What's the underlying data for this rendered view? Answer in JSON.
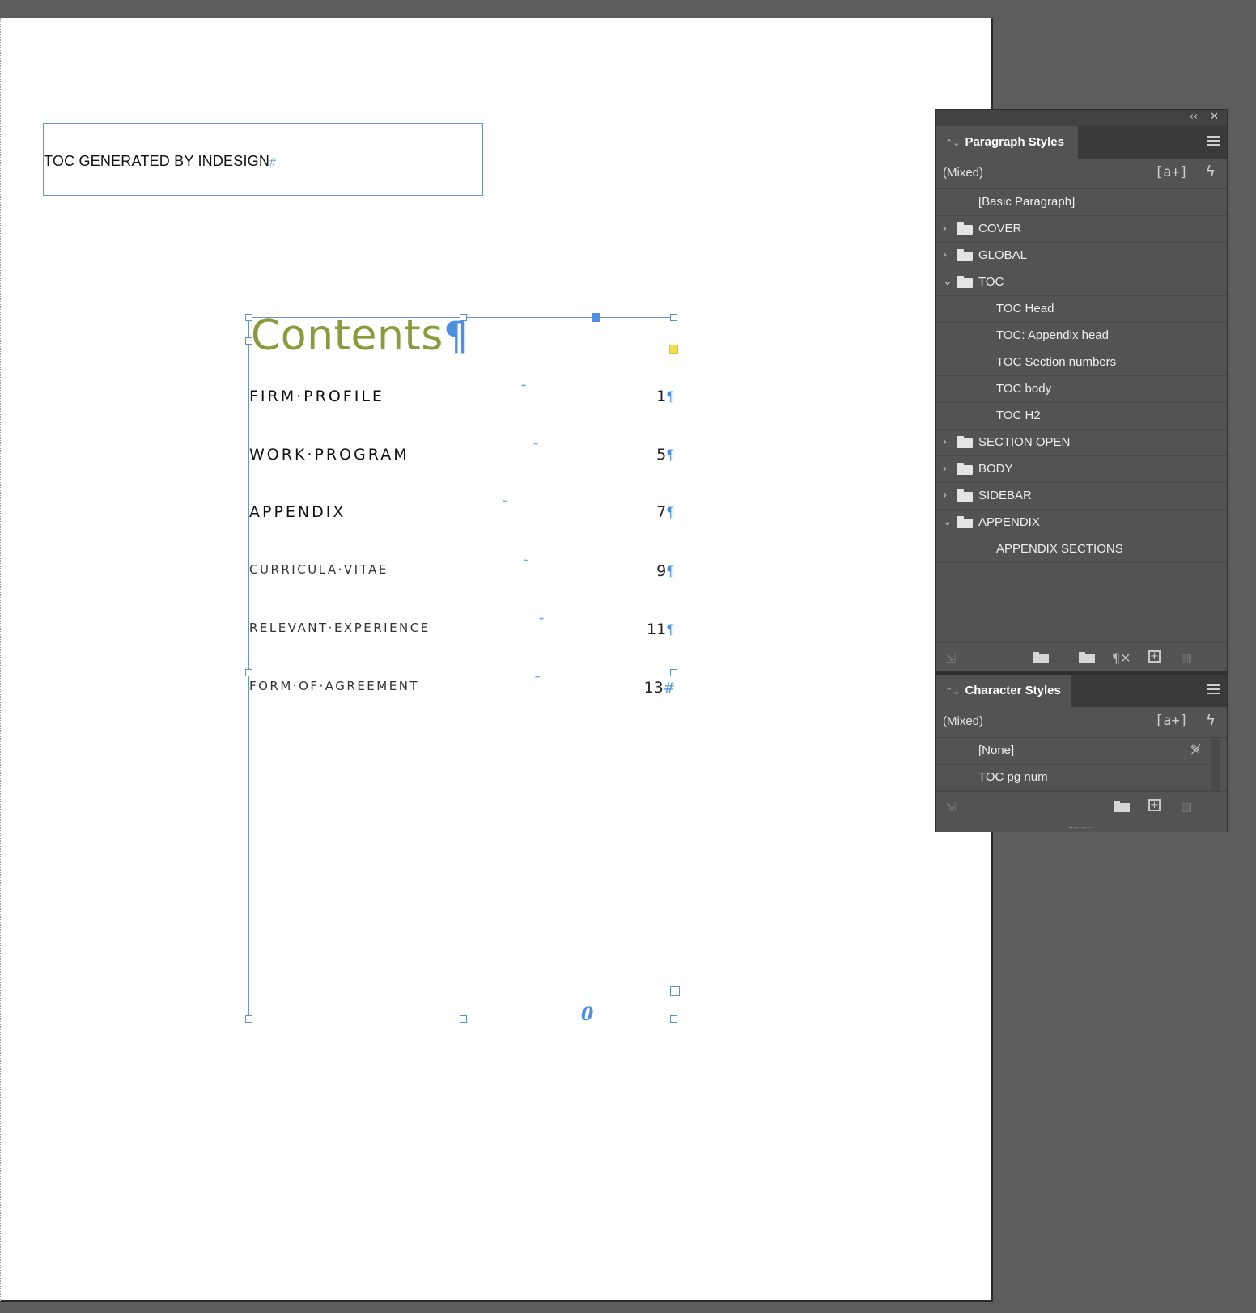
{
  "document": {
    "header_frame_text": "TOC GENERATED BY INDESIGN",
    "header_frame_marker": "#",
    "toc_title": "Contents",
    "pilcrow": "¶",
    "tab_marker": "˜",
    "overset_port": "0",
    "toc_entries": [
      {
        "label": "FIRM·PROFILE",
        "page": "1",
        "level": 1,
        "end": "¶"
      },
      {
        "label": "WORK·PROGRAM",
        "page": "5",
        "level": 1,
        "end": "¶"
      },
      {
        "label": "APPENDIX",
        "page": "7",
        "level": 1,
        "end": "¶"
      },
      {
        "label": "CURRICULA·VITAE",
        "page": "9",
        "level": 2,
        "end": "¶"
      },
      {
        "label": "RELEVANT·EXPERIENCE",
        "page": "11",
        "level": 2,
        "end": "¶"
      },
      {
        "label": "FORM·OF·AGREEMENT",
        "page": "13",
        "level": 2,
        "end": "#"
      }
    ]
  },
  "topbar": {
    "collapse_icon": "‹‹",
    "close_icon": "✕"
  },
  "paragraph_styles": {
    "tab_label": "Paragraph Styles",
    "updown_icon": "⌃⌄",
    "current": "(Mixed)",
    "new_style_icon": "[a+]",
    "bolt_icon": "ϟ",
    "items": [
      {
        "name": "[Basic Paragraph]",
        "type": "style",
        "indent": 0
      },
      {
        "name": "COVER",
        "type": "group",
        "expanded": false
      },
      {
        "name": "GLOBAL",
        "type": "group",
        "expanded": false
      },
      {
        "name": "TOC",
        "type": "group",
        "expanded": true
      },
      {
        "name": "TOC Head",
        "type": "style",
        "indent": 1
      },
      {
        "name": "TOC: Appendix head",
        "type": "style",
        "indent": 1
      },
      {
        "name": "TOC Section numbers",
        "type": "style",
        "indent": 1
      },
      {
        "name": "TOC body",
        "type": "style",
        "indent": 1
      },
      {
        "name": "TOC H2",
        "type": "style",
        "indent": 1
      },
      {
        "name": "SECTION OPEN",
        "type": "group",
        "expanded": false
      },
      {
        "name": "BODY",
        "type": "group",
        "expanded": false
      },
      {
        "name": "SIDEBAR",
        "type": "group",
        "expanded": false
      },
      {
        "name": "APPENDIX",
        "type": "group",
        "expanded": true
      },
      {
        "name": "APPENDIX SECTIONS",
        "type": "style",
        "indent": 1
      }
    ]
  },
  "character_styles": {
    "tab_label": "Character Styles",
    "updown_icon": "⌃⌄",
    "current": "(Mixed)",
    "new_style_icon": "[a+]",
    "bolt_icon": "ϟ",
    "items": [
      {
        "name": "[None]",
        "locked": true
      },
      {
        "name": "TOC pg num",
        "locked": false
      }
    ]
  },
  "colors": {
    "accent_title": "#8b9a3a",
    "frame_blue": "#4d8fe0",
    "panel_bg": "#535353"
  }
}
